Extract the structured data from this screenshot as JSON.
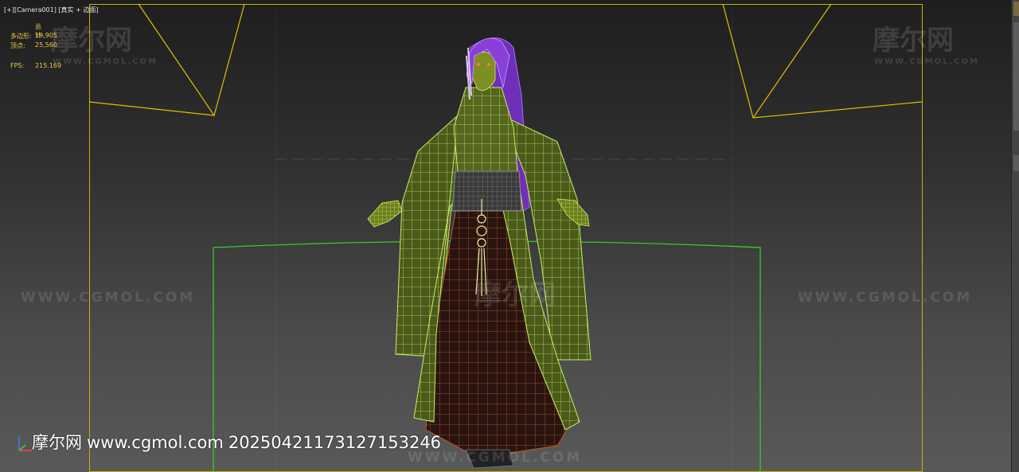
{
  "viewport": {
    "label_parts": [
      "[+]",
      "[Camera001]",
      "[真实 + 边面]"
    ],
    "stats": {
      "header": "总计",
      "polys_label": "多边形:",
      "polys_value": "19,905",
      "verts_label": "顶点:",
      "verts_value": "25,560",
      "fps_label": "FPS:",
      "fps_value": "215.169"
    }
  },
  "watermarks": {
    "logo_text": "摩尔网",
    "url_small": "WWW.CGMOL.COM",
    "url_large": "WWW.CGMOL.COM"
  },
  "footer": {
    "site_cn": "摩尔网",
    "site_url": "www.cgmol.com",
    "stamp": "20250421173127153246"
  },
  "colors": {
    "safe_frame": "#c8b400",
    "camera_frustum": "#e0c000",
    "selection_box": "#3ecf2c",
    "robe_wire": "#c9f06a",
    "robe_fill": "#5d6b22",
    "skirt_wire": "#b85b2a",
    "skirt_fill": "#2a1410",
    "hair": "#8a3fd8",
    "skin_wire": "#c8e04a",
    "belt": "#5a5a5a"
  },
  "icons": [
    "axis-gizmo-icon",
    "viewport-label-menu"
  ]
}
